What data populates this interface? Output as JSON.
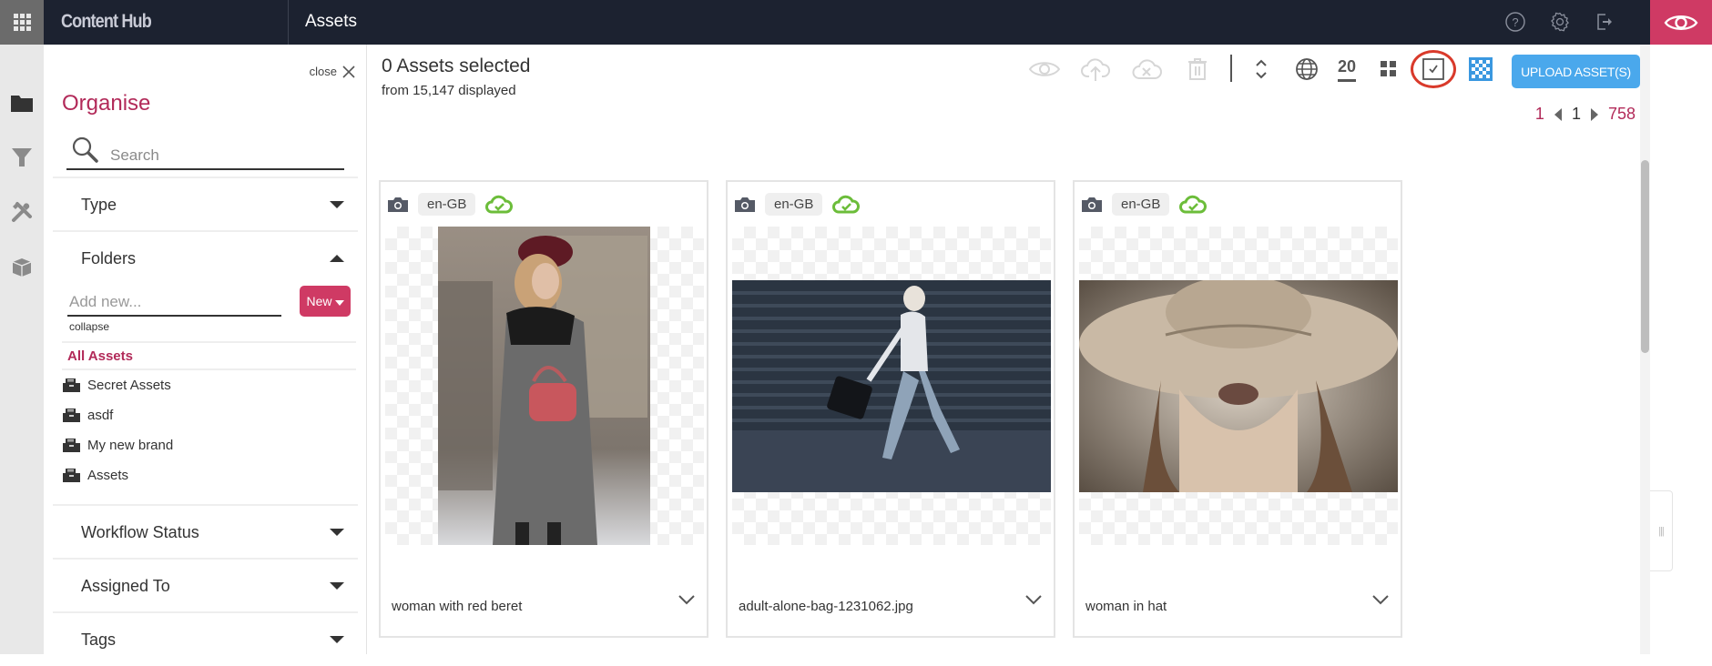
{
  "topbar": {
    "brand": "Content Hub",
    "page_name": "Assets",
    "icons": [
      "help-icon",
      "settings-gear-icon",
      "logout-icon",
      "preview-eye-icon"
    ]
  },
  "rail": {
    "items": [
      "folder-icon",
      "filter-icon",
      "tools-icon",
      "package-box-icon"
    ]
  },
  "panel": {
    "close_label": "close",
    "title": "Organise",
    "search_placeholder": "Search",
    "sections": {
      "type": "Type",
      "folders": "Folders",
      "workflow": "Workflow Status",
      "assigned": "Assigned To",
      "tags": "Tags"
    },
    "folders": {
      "add_placeholder": "Add new...",
      "new_button": "New",
      "collapse_label": "collapse",
      "all_assets": "All Assets",
      "items": [
        {
          "label": "Secret Assets"
        },
        {
          "label": "asdf"
        },
        {
          "label": "My new brand"
        },
        {
          "label": "Assets"
        }
      ]
    }
  },
  "main": {
    "selected_count": "0 Assets selected",
    "displayed": "from 15,147 displayed",
    "toolbar": {
      "icons": [
        "preview-icon",
        "upload-cloud-icon",
        "remove-cloud-icon",
        "delete-trash-icon",
        "sort-toggle-icon",
        "language-globe-icon",
        "grid-view-icon",
        "select-checkbox-icon",
        "transparency-icon"
      ],
      "per_page": "20",
      "upload_label": "UPLOAD ASSET(S)"
    },
    "pager": {
      "first": "1",
      "current": "1",
      "last": "758"
    },
    "colors": {
      "accent": "#b22a59",
      "primary_button": "#4aa8ec",
      "status_ok": "#6cbd3a",
      "topbar": "#1c2230"
    },
    "assets": [
      {
        "name": "woman with red beret",
        "lang": "en-GB",
        "status": "published"
      },
      {
        "name": "adult-alone-bag-1231062.jpg",
        "lang": "en-GB",
        "status": "published"
      },
      {
        "name": "woman in hat",
        "lang": "en-GB",
        "status": "published"
      }
    ]
  }
}
